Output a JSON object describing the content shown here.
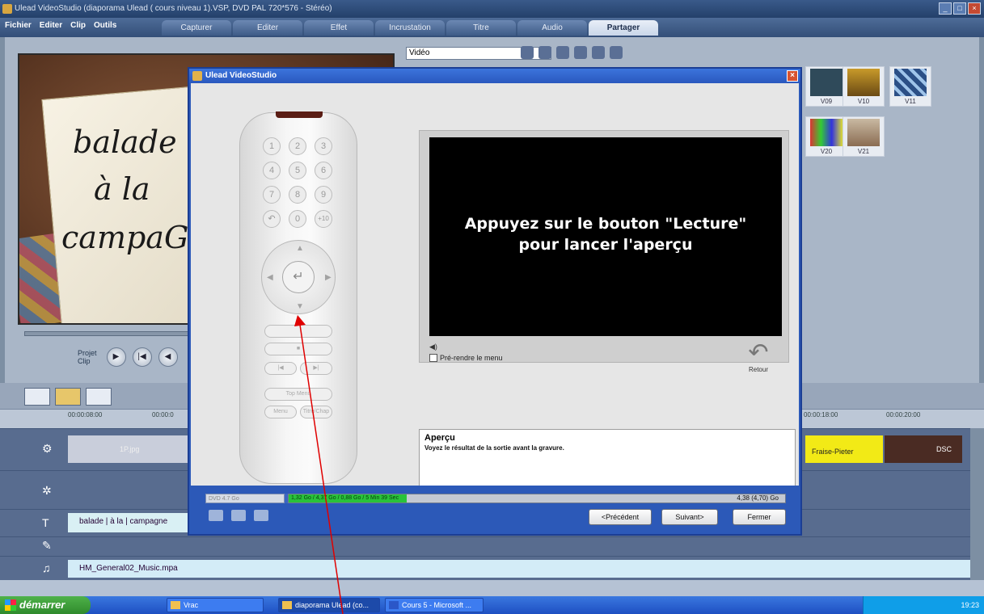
{
  "window": {
    "title": "Ulead VideoStudio (diaporama Ulead ( cours niveau 1).VSP, DVD PAL 720*576 - Stéréo)"
  },
  "menu": [
    "Fichier",
    "Editer",
    "Clip",
    "Outils"
  ],
  "tabs": [
    {
      "label": "Capturer",
      "active": false
    },
    {
      "label": "Editer",
      "active": false
    },
    {
      "label": "Effet",
      "active": false
    },
    {
      "label": "Incrustation",
      "active": false
    },
    {
      "label": "Titre",
      "active": false
    },
    {
      "label": "Audio",
      "active": false
    },
    {
      "label": "Partager",
      "active": true
    }
  ],
  "preview": {
    "handwriting": [
      "balade",
      "à la",
      "campaGne"
    ]
  },
  "player": {
    "mode_label_1": "Projet",
    "mode_label_2": "Clip"
  },
  "library": {
    "dropdown": "Vidéo",
    "thumbs": [
      "V09",
      "V10",
      "V11",
      "V20",
      "V21"
    ]
  },
  "timeline": {
    "ruler": [
      "00:00:08:00",
      "00:00:0",
      "00:00:18:00",
      "00:00:20:00"
    ],
    "clips": {
      "video1": "1P.jpg",
      "video2": "DSC",
      "overlay": "Fraise-Pieter"
    },
    "title_clip": "balade | à la | campagne",
    "music_clip": "HM_General02_Music.mpa"
  },
  "dialog": {
    "title": "Ulead VideoStudio",
    "screen_line1": "Appuyez sur le bouton \"Lecture\"",
    "screen_line2": "pour lancer l'aperçu",
    "prerender_label": "Pré-rendre le menu",
    "back_label": "Retour",
    "info_title": "Aperçu",
    "info_desc": "Voyez le résultat de la sortie avant la gravure.",
    "disc_select": "DVD 4.7 Go",
    "usage_text": "1,32 Go / 4,37 Go / 0,88 Go / 5 Min 39 Sec",
    "capacity": "4,38 (4,70) Go",
    "buttons": {
      "prev": "<Précédent",
      "next": "Suivant>",
      "close": "Fermer"
    }
  },
  "remote": {
    "keys": [
      "1",
      "2",
      "3",
      "4",
      "5",
      "6",
      "7",
      "8",
      "9",
      "↶",
      "0",
      "+10"
    ],
    "buttons": [
      "Top Menu",
      "Menu",
      "Titre/Chap"
    ]
  },
  "taskbar": {
    "start": "démarrer",
    "items": [
      "Vrac",
      "diaporama Ulead (co...",
      "Cours 5 - Microsoft ..."
    ],
    "clock": "19:23"
  },
  "colors": {
    "accent": "#2c59b8",
    "progress": "#29c33a",
    "arrow": "#e00000"
  }
}
